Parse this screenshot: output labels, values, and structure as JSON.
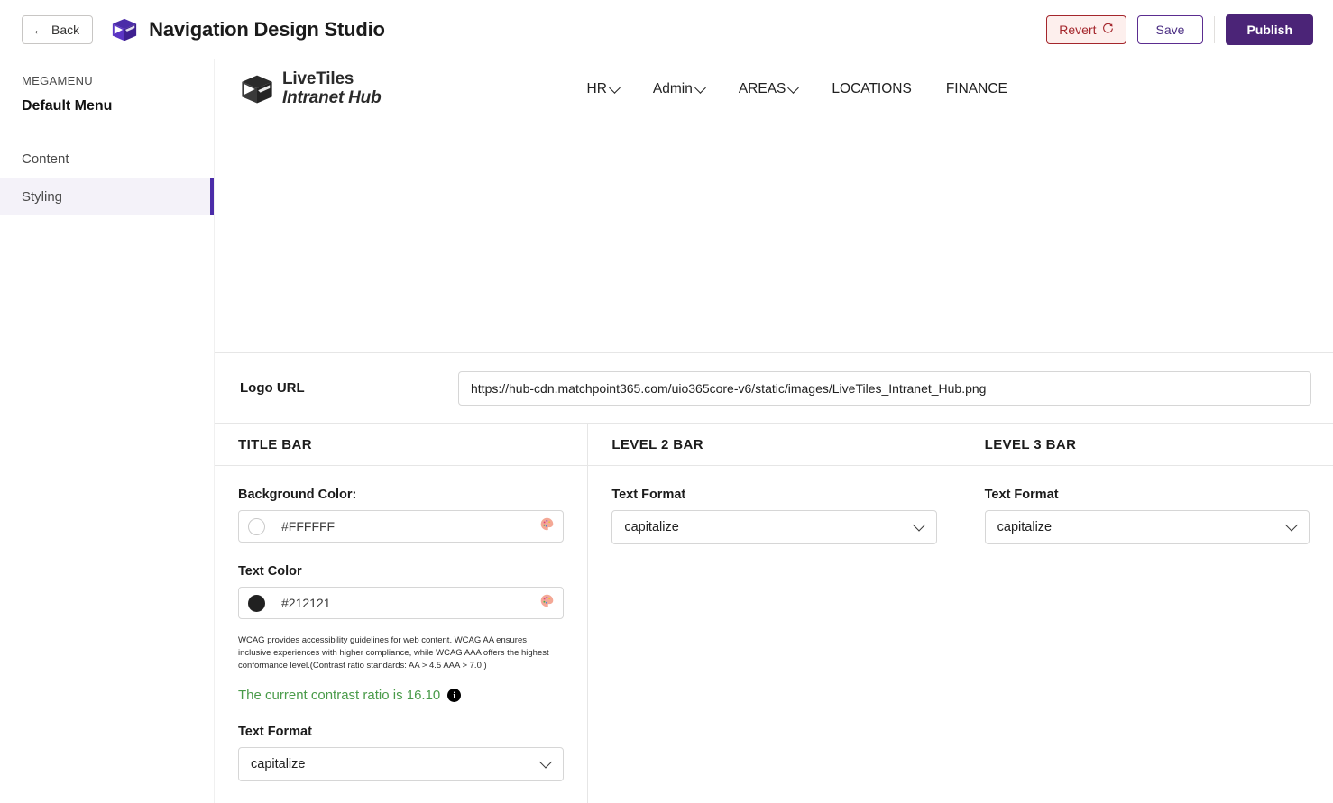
{
  "appbar": {
    "back_label": "Back",
    "back_icon": "arrow-left-icon",
    "app_title": "Navigation Design Studio",
    "app_logo_icon": "livetiles-cube-icon",
    "revert_label": "Revert",
    "revert_icon": "refresh-icon",
    "save_label": "Save",
    "publish_label": "Publish",
    "colors": {
      "publish_bg": "#4B2477",
      "revert_fg": "#A4262C",
      "revert_bg": "#FDEFED",
      "save_fg": "#4B2E83"
    }
  },
  "sidebar": {
    "eyebrow": "MEGAMENU",
    "menu_name": "Default Menu",
    "items": [
      {
        "label": "Content",
        "active": false
      },
      {
        "label": "Styling",
        "active": true
      }
    ],
    "active_rail_color": "#4B2CA8",
    "active_row_bg": "#F4F2F9"
  },
  "preview": {
    "logo_icon": "livetiles-cube-icon",
    "logo_line1": "LiveTiles",
    "logo_line2": "Intranet Hub",
    "nav": [
      {
        "label": "HR",
        "has_chevron": true
      },
      {
        "label": "Admin",
        "has_chevron": true
      },
      {
        "label": "AREAS",
        "has_chevron": true
      },
      {
        "label": "LOCATIONS",
        "has_chevron": false
      },
      {
        "label": "FINANCE",
        "has_chevron": false
      }
    ]
  },
  "logo_url_field": {
    "label": "Logo URL",
    "value": "https://hub-cdn.matchpoint365.com/uio365core-v6/static/images/LiveTiles_Intranet_Hub.png",
    "placeholder": "Logo URL"
  },
  "columns": {
    "title_bar": {
      "heading": "TITLE BAR",
      "background_color": {
        "label": "Background Color:",
        "value": "#FFFFFF",
        "swatch_hex": "#FFFFFF",
        "palette_icon": "color-palette-icon"
      },
      "text_color": {
        "label": "Text Color",
        "value": "#212121",
        "swatch_hex": "#212121",
        "palette_icon": "color-palette-icon"
      },
      "wcag_note": "WCAG provides accessibility guidelines for web content. WCAG AA ensures inclusive experiences with higher compliance, while WCAG AAA offers the highest conformance level.(Contrast ratio standards: AA > 4.5 AAA > 7.0 )",
      "contrast_text": "The current contrast ratio is 16.10",
      "contrast_color": "#4A9B4A",
      "contrast_info_icon": "info-icon",
      "text_format": {
        "label": "Text Format",
        "value": "capitalize",
        "chevron_icon": "chevron-down-icon"
      }
    },
    "level_2_bar": {
      "heading": "LEVEL 2 BAR",
      "text_format": {
        "label": "Text Format",
        "value": "capitalize",
        "chevron_icon": "chevron-down-icon"
      }
    },
    "level_3_bar": {
      "heading": "LEVEL 3 BAR",
      "text_format": {
        "label": "Text Format",
        "value": "capitalize",
        "chevron_icon": "chevron-down-icon"
      }
    }
  }
}
